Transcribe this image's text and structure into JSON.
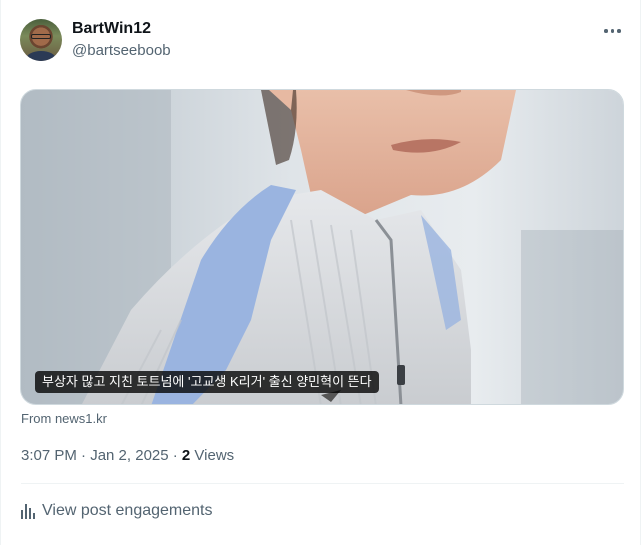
{
  "author": {
    "display_name": "BartWin12",
    "handle": "@bartseeboob"
  },
  "media": {
    "caption": "부상자 많고 지친 토트넘에 '고교생 K리거' 출신 양민혁이 뜬다",
    "source": "From news1.kr"
  },
  "meta": {
    "timestamp": "3:07 PM · Jan 2, 2025 · ",
    "views_count": "2",
    "views_label": " Views"
  },
  "actions": {
    "engagements_label": "View post engagements",
    "more_icon": "more-horizontal-icon",
    "engagements_icon": "analytics-bars-icon"
  }
}
